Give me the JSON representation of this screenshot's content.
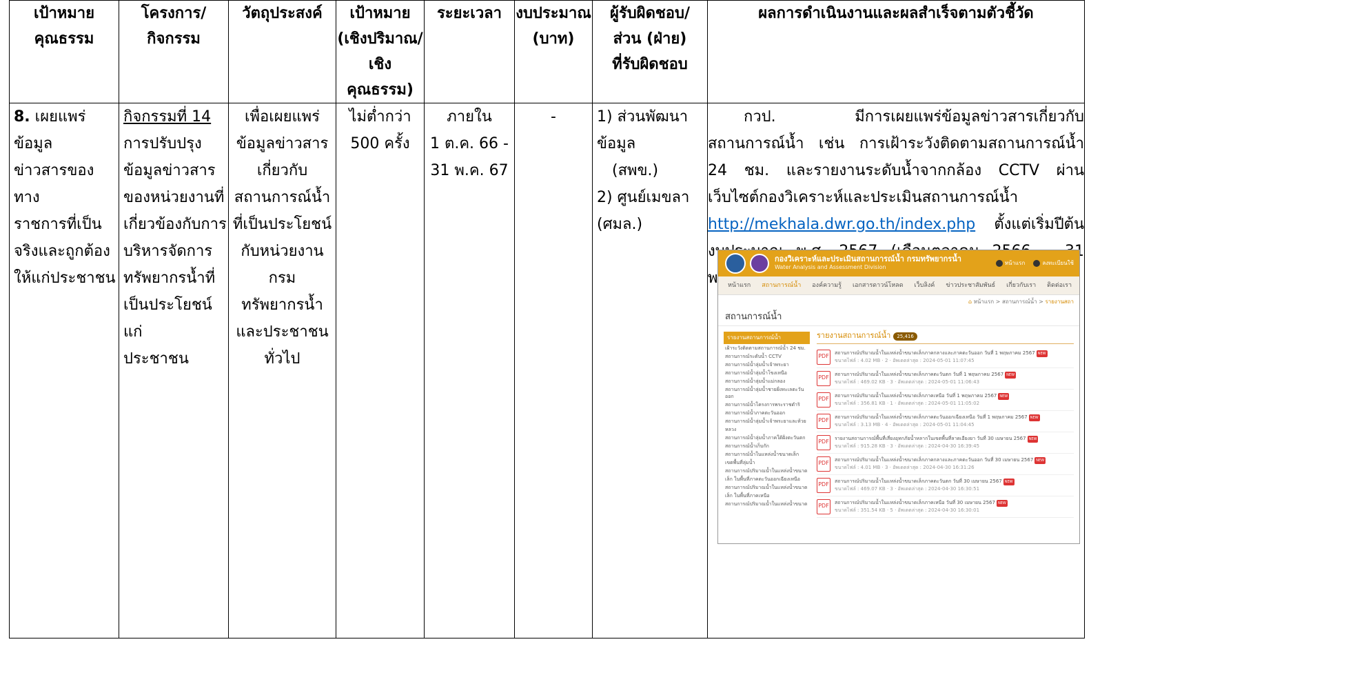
{
  "headers": {
    "c1": [
      "เป้าหมาย",
      "คุณธรรม"
    ],
    "c2": [
      "โครงการ/",
      "กิจกรรม"
    ],
    "c3": [
      "วัตถุประสงค์"
    ],
    "c4": [
      "เป้าหมาย",
      "(เชิงปริมาณ/",
      "เชิงคุณธรรม)"
    ],
    "c5": [
      "ระยะเวลา"
    ],
    "c6": [
      "งบประมาณ",
      "(บาท)"
    ],
    "c7": [
      "ผู้รับผิดชอบ/",
      "ส่วน (ฝ่าย)",
      "ที่รับผิดชอบ"
    ],
    "c8": [
      "ผลการดำเนินงานและผลสำเร็จตามตัวชี้วัด"
    ]
  },
  "row": {
    "goal_num": "8.",
    "goal": [
      "เผยแพร่ข้อมูล",
      "ข่าวสารของทาง",
      "ราชการที่เป็น",
      "จริงและถูกต้อง",
      "ให้แก่ประชาชน"
    ],
    "activity_title": "กิจกรรมที่ 14",
    "activity": [
      "การปรับปรุง",
      "ข้อมูลข่าวสาร",
      "ของหน่วยงานที่",
      "เกี่ยวข้องกับการ",
      "บริหารจัดการ",
      "ทรัพยากรน้ำที่",
      "เป็นประโยชน์แก่",
      "ประชาชน"
    ],
    "objective": [
      "เพื่อเผยแพร่",
      "ข้อมูลข่าวสาร",
      "เกี่ยวกับ",
      "สถานการณ์น้ำ",
      "ที่เป็นประโยชน์",
      "กับหน่วยงานกรม",
      "ทรัพยากรน้ำ",
      "และประชาชน",
      "ทั่วไป"
    ],
    "target": [
      "ไม่ต่ำกว่า",
      "500 ครั้ง"
    ],
    "period": [
      "ภายใน",
      "1 ต.ค. 66 -",
      "31 พ.ค. 67"
    ],
    "budget": "-",
    "responsible": [
      "1) ส่วนพัฒนาข้อมูล",
      "(สพข.)",
      "2) ศูนย์เมขลา (ศมล.)"
    ],
    "result_text_1": "กวป. มีการเผยแพร่ข้อมูลข่าวสารเกี่ยวกับสถานการณ์น้ำ เช่น การเฝ้าระวังติดตามสถานการณ์น้ำ 24 ชม. และรายงานระดับน้ำจากกล้อง CCTV ผ่านเว็บไซต์กองวิเคราะห์และประเมินสถานการณ์น้ำ",
    "result_link": "http://mekhala.dwr.go.th/index.php",
    "result_text_2": "ตั้งแต่เริ่มปีต้นงบประมาณ พ.ศ. 2567 (เดือนตุลาคม 2566 – 31 พฤษภาคม 2567) รวมจำนวน 631 ครั้ง"
  },
  "screenshot": {
    "site_title": "กองวิเคราะห์และประเมินสถานการณ์น้ำ กรมทรัพยากรน้ำ",
    "site_subtitle": "Water Analysis and Assessment Division",
    "header_links": [
      "หน้าแรก",
      "ลงทะเบียนใช้"
    ],
    "nav": [
      "หน้าแรก",
      "สถานการณ์น้ำ",
      "องค์ความรู้",
      "เอกสารดาวน์โหลด",
      "เว็บลิงค์",
      "ข่าวประชาสัมพันธ์",
      "เกี่ยวกับเรา",
      "ติดต่อเรา"
    ],
    "breadcrumb_home": "หน้าแรก",
    "breadcrumb_mid": "สถานการณ์น้ำ",
    "breadcrumb_last": "รายงานสถา",
    "page_title": "สถานการณ์น้ำ",
    "side_header": "รายงานสถานการณ์น้ำ",
    "side_items": [
      "เฝ้าระวังติดตามสถานการณ์น้ำ 24 ชม.",
      "สถานการณ์ระดับน้ำ CCTV",
      "สถานการณ์น้ำลุ่มน้ำเจ้าพระยา",
      "สถานการณ์น้ำลุ่มน้ำโขงเหนือ",
      "สถานการณ์น้ำลุ่มน้ำแม่กลอง",
      "สถานการณ์น้ำลุ่มน้ำชายฝั่งทะเลตะวันออก",
      "สถานการณ์น้ำโครงการพระราชดำริ",
      "สถานการณ์น้ำภาคตะวันออก",
      "สถานการณ์น้ำลุ่มน้ำเจ้าพระยาและห้วย",
      "หลวง",
      "สถานการณ์น้ำลุ่มน้ำภาคใต้ฝั่งตะวันตก",
      "สถานการณ์น้ำเก็บกัก",
      "สถานการณ์น้ำในแหล่งน้ำขนาดเล็ก",
      "เขตพื้นที่ลุ่มน้ำ",
      "สถานการณ์ปริมาณน้ำในแหล่งน้ำขนาด",
      "เล็ก ในพื้นที่ภาคตะวันออกเฉียงเหนือ",
      "สถานการณ์ปริมาณน้ำในแหล่งน้ำขนาด",
      "เล็ก ในพื้นที่ภาคเหนือ",
      "สถานการณ์ปริมาณน้ำในแหล่งน้ำขนาด"
    ],
    "main_header": "รายงานสถานการณ์น้ำ",
    "main_count": "25,416",
    "pdf_label": "PDF",
    "new_label": "NEW",
    "items": [
      {
        "title": "สถานการณ์ปริมาณน้ำในแหล่งน้ำขนาดเล็กภาคกลางและภาคตะวันออก วันที่ 1 พฤษภาคม 2567",
        "meta": "ขนาดไฟล์ : 4.02 MB · 2 · อัพเดตล่าสุด : 2024-05-01 11:07:45"
      },
      {
        "title": "สถานการณ์ปริมาณน้ำในแหล่งน้ำขนาดเล็กภาคตะวันตก วันที่ 1 พฤษภาคม 2567",
        "meta": "ขนาดไฟล์ : 469.02 KB · 3 · อัพเดตล่าสุด : 2024-05-01 11:06:43"
      },
      {
        "title": "สถานการณ์ปริมาณน้ำในแหล่งน้ำขนาดเล็กภาคเหนือ วันที่ 1 พฤษภาคม 2567",
        "meta": "ขนาดไฟล์ : 356.81 KB · 1 · อัพเดตล่าสุด : 2024-05-01 11:05:02"
      },
      {
        "title": "สถานการณ์ปริมาณน้ำในแหล่งน้ำขนาดเล็กภาคตะวันออกเฉียงเหนือ วันที่ 1 พฤษภาคม 2567",
        "meta": "ขนาดไฟล์ : 3.13 MB · 4 · อัพเดตล่าสุด : 2024-05-01 11:04:45"
      },
      {
        "title": "รายงานสถานการณ์พื้นที่เสี่ยงอุทกภัยน้ำหลากในเขตพื้นที่ลาดเอียงยา วันที่ 30 เมษายน 2567",
        "meta": "ขนาดไฟล์ : 915.28 KB · 3 · อัพเดตล่าสุด : 2024-04-30 16:39:45"
      },
      {
        "title": "สถานการณ์ปริมาณน้ำในแหล่งน้ำขนาดเล็กภาคกลางและภาคตะวันออก วันที่ 30 เมษายน 2567",
        "meta": "ขนาดไฟล์ : 4.01 MB · 3 · อัพเดตล่าสุด : 2024-04-30 16:31:26"
      },
      {
        "title": "สถานการณ์ปริมาณน้ำในแหล่งน้ำขนาดเล็กภาคตะวันตก วันที่ 30 เมษายน 2567",
        "meta": "ขนาดไฟล์ : 469.07 KB · 3 · อัพเดตล่าสุด : 2024-04-30 16:30:51"
      },
      {
        "title": "สถานการณ์ปริมาณน้ำในแหล่งน้ำขนาดเล็กภาคเหนือ วันที่ 30 เมษายน 2567",
        "meta": "ขนาดไฟล์ : 351.54 KB · 5 · อัพเดตล่าสุด : 2024-04-30 16:30:01"
      }
    ]
  }
}
